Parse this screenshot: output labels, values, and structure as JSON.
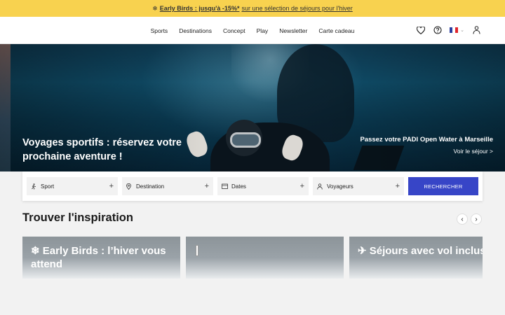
{
  "promo": {
    "icon": "snowflake-icon",
    "link_text": "Early Birds : jusqu'à -15%*",
    "rest_text": "sur une sélection de séjours pour l'hiver",
    "bg_color": "#f8d24f"
  },
  "nav": {
    "items": [
      "Sports",
      "Destinations",
      "Concept",
      "Play",
      "Newsletter",
      "Carte cadeau"
    ]
  },
  "header_icons": {
    "favorites": "heart-icon",
    "help": "question-circle-icon",
    "language": "french-flag-icon",
    "account": "user-icon"
  },
  "hero": {
    "title": "Voyages sportifs : réservez votre prochaine aventure !",
    "promo_title": "Passez votre PADI Open Water à Marseille",
    "promo_link": "Voir le séjour >"
  },
  "search": {
    "sport": "Sport",
    "destination": "Destination",
    "dates": "Dates",
    "travelers": "Voyageurs",
    "button": "Rechercher",
    "button_color": "#3745c7"
  },
  "inspiration": {
    "title": "Trouver l'inspiration",
    "cards": [
      {
        "title": "❄ Early Birds : l’hiver vous attend"
      },
      {
        "title": ""
      },
      {
        "title": "✈ Séjours avec vol inclus"
      }
    ]
  }
}
